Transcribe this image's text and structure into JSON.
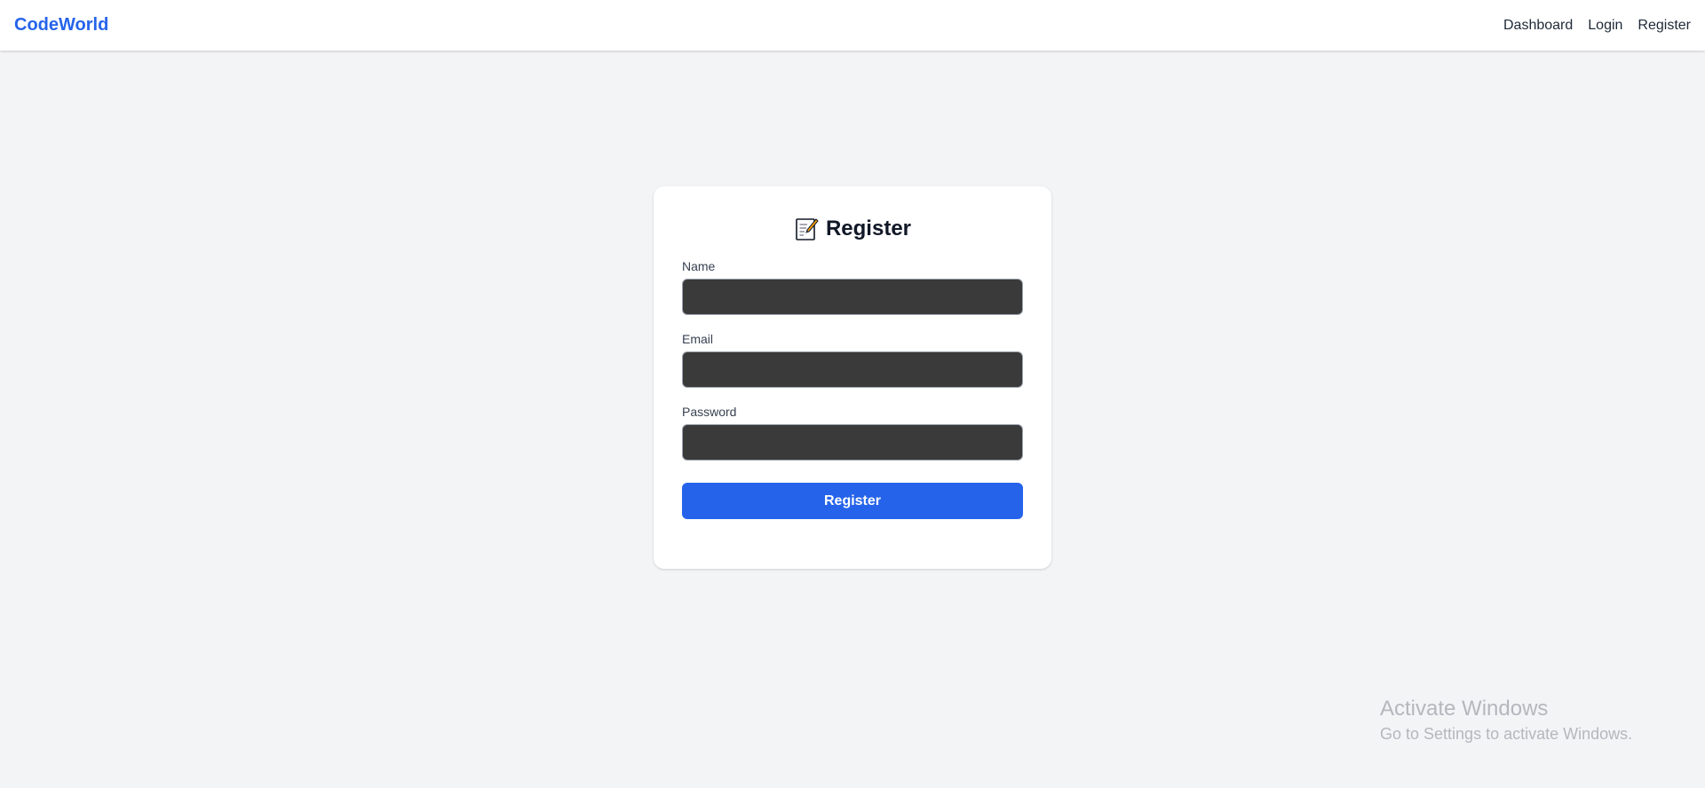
{
  "navbar": {
    "brand": "CodeWorld",
    "links": [
      {
        "label": "Dashboard"
      },
      {
        "label": "Login"
      },
      {
        "label": "Register"
      }
    ]
  },
  "register_card": {
    "title": "Register",
    "title_icon": "memo-icon",
    "fields": [
      {
        "label": "Name",
        "value": "",
        "placeholder": ""
      },
      {
        "label": "Email",
        "value": "",
        "placeholder": ""
      },
      {
        "label": "Password",
        "value": "",
        "placeholder": ""
      }
    ],
    "submit_label": "Register"
  },
  "windows_watermark": {
    "line1": "Activate Windows",
    "line2": "Go to Settings to activate Windows."
  },
  "colors": {
    "brand": "#2563eb",
    "page_background": "#f3f4f6",
    "input_background": "#3a3a3a",
    "button_background": "#2563eb"
  }
}
